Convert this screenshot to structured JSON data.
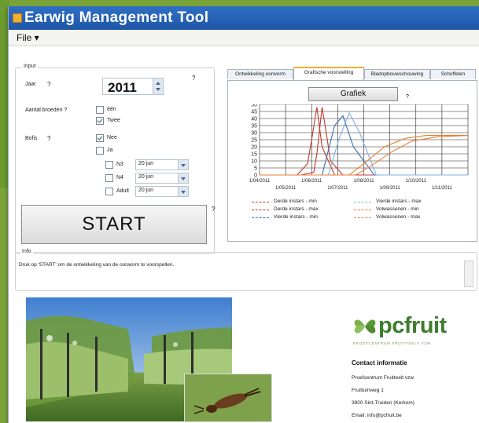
{
  "window": {
    "title": "Earwig Management Tool"
  },
  "menu": {
    "file": "File ▾"
  },
  "input": {
    "group_label": "Input",
    "year_label": "Jaar",
    "year_help": "?",
    "year_value": "2011",
    "help": "?",
    "broods_label": "Aantal broeden ?",
    "brood_options": [
      {
        "label": "één",
        "checked": false
      },
      {
        "label": "Twee",
        "checked": true
      }
    ],
    "sampling_label": "Bofis",
    "sampling_help": "?",
    "sampling_options": [
      {
        "label": "Nee",
        "checked": true
      },
      {
        "label": "Ja",
        "checked": false
      }
    ],
    "stages": [
      {
        "label": "N3",
        "checked": false,
        "value": "20 jun"
      },
      {
        "label": "N4",
        "checked": false,
        "value": "20 jun"
      },
      {
        "label": "Adult",
        "checked": false,
        "value": "20 jun"
      }
    ]
  },
  "start": {
    "label": "START",
    "help": "?"
  },
  "tabs": [
    {
      "label": "Ontwikkeling oorworm",
      "active": false
    },
    {
      "label": "Grafische voorstelling",
      "active": true
    },
    {
      "label": "Bladopbouwschouwing",
      "active": false
    },
    {
      "label": "Schoffelen",
      "active": false
    }
  ],
  "graph": {
    "button_label": "Grafiek",
    "help": "?"
  },
  "chart_data": {
    "type": "line",
    "x_ticks_upper": [
      "1/04/2011",
      "1/06/2011",
      "1/08/2011",
      "1/10/2011"
    ],
    "x_ticks_lower": [
      "1/05/2011",
      "1/07/2011",
      "1/09/2011",
      "1/11/2011"
    ],
    "ylim": [
      0,
      50
    ],
    "y_ticks": [
      "0",
      "5",
      "10",
      "15",
      "20",
      "25",
      "30",
      "35",
      "40",
      "45",
      "50"
    ],
    "grid": true,
    "legend_position": "bottom",
    "series": [
      {
        "name": "Derde instars - min",
        "color": "#c0392b",
        "x": [
          0,
          40,
          52,
          55,
          60,
          64,
          68,
          80,
          200
        ],
        "y": [
          0,
          0,
          2,
          15,
          48,
          30,
          10,
          0,
          0
        ]
      },
      {
        "name": "Derde instars - max",
        "color": "#c0392b",
        "x": [
          0,
          36,
          46,
          50,
          55,
          60,
          72,
          200
        ],
        "y": [
          0,
          0,
          8,
          25,
          48,
          20,
          0,
          0
        ]
      },
      {
        "name": "Vierde instars - min",
        "color": "#3a6fb5",
        "x": [
          0,
          60,
          72,
          80,
          90,
          110,
          200
        ],
        "y": [
          0,
          0,
          35,
          42,
          20,
          0,
          0
        ]
      },
      {
        "name": "Vierde instars - max",
        "color": "#7fb0e0",
        "x": [
          0,
          66,
          76,
          86,
          96,
          112,
          200
        ],
        "y": [
          0,
          0,
          25,
          44,
          30,
          0,
          0
        ]
      },
      {
        "name": "Volwassenen - min",
        "color": "#e67e22",
        "x": [
          0,
          86,
          100,
          120,
          140,
          160,
          200
        ],
        "y": [
          0,
          0,
          8,
          20,
          26,
          28,
          28
        ]
      },
      {
        "name": "Volwassenen - max",
        "color": "#e87d3e",
        "x": [
          0,
          92,
          106,
          126,
          146,
          170,
          200
        ],
        "y": [
          0,
          0,
          6,
          16,
          24,
          27,
          28
        ]
      }
    ]
  },
  "info": {
    "group_label": "Info",
    "text": "Druk op 'START' om de ontwikkeling van de oorworm te voorspellen."
  },
  "contact": {
    "brand": "pcfruit",
    "tagline": "PROEFCENTRUM FRUITTEELT VZW",
    "title": "Contact informatie",
    "lines": [
      "Proefcentrum Fruitteelt vzw",
      "Fruittuinweg 1",
      "3800 Sint-Truiden (Kerkom)",
      "Email: info@pcfruit.be"
    ]
  },
  "colors": {
    "accent": "#f0b030",
    "titlebar": "#1f56a8",
    "brand_green": "#3f7d2f",
    "bg_green": "#7aa33a"
  }
}
